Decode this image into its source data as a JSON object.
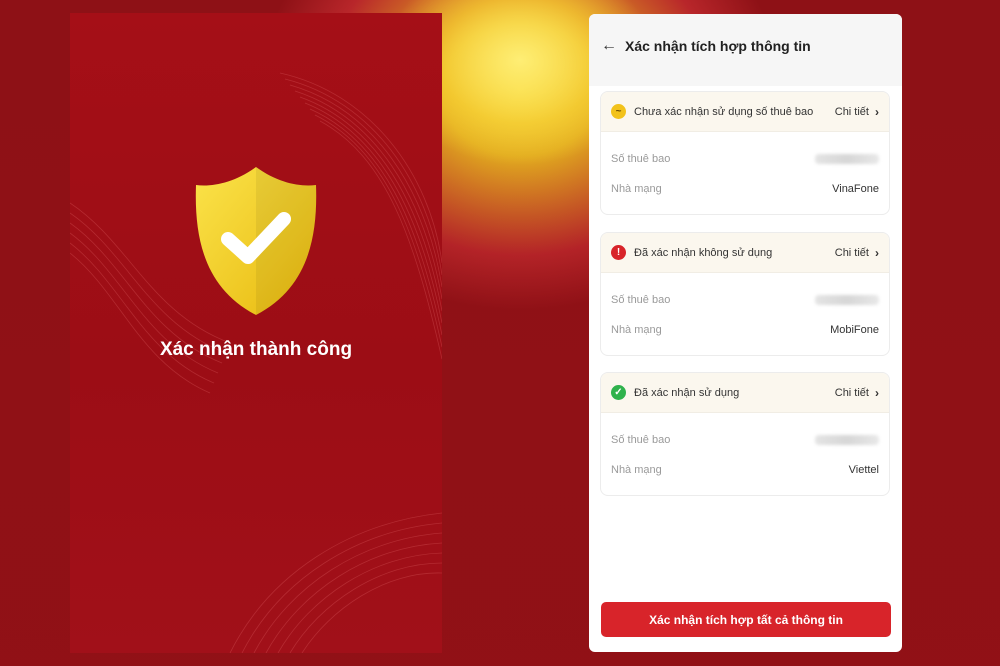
{
  "left_screen": {
    "title": "Xác nhận thành công",
    "shield_icon": "shield-check-icon",
    "colors": {
      "background": "#a50f17",
      "shield": "#f5d21e",
      "check": "#ffffff"
    }
  },
  "right_screen": {
    "header": {
      "back_icon": "arrow-left-icon",
      "back_glyph": "←",
      "title": "Xác nhận tích hợp thông tin"
    },
    "cards": [
      {
        "status": "Chưa xác nhận sử dụng số thuê bao",
        "status_icon": "pending-icon",
        "status_glyph": "~",
        "status_color": "#f2c21b",
        "detail_label": "Chi tiết",
        "fields": [
          {
            "label": "Số thuê bao",
            "value": ""
          },
          {
            "label": "Nhà mạng",
            "value": "VinaFone"
          }
        ]
      },
      {
        "status": "Đã xác nhận không sử dụng",
        "status_icon": "error-icon",
        "status_glyph": "!",
        "status_color": "#d8242a",
        "detail_label": "Chi tiết",
        "fields": [
          {
            "label": "Số thuê bao",
            "value": ""
          },
          {
            "label": "Nhà mạng",
            "value": "MobiFone"
          }
        ]
      },
      {
        "status": "Đã xác nhận sử dụng",
        "status_icon": "check-circle-icon",
        "status_glyph": "✓",
        "status_color": "#2fb24c",
        "detail_label": "Chi tiết",
        "fields": [
          {
            "label": "Số thuê bao",
            "value": ""
          },
          {
            "label": "Nhà mạng",
            "value": "Viettel"
          }
        ]
      }
    ],
    "cta_label": "Xác nhận tích hợp tất cả thông tin",
    "colors": {
      "cta": "#d8242a",
      "card_header": "#fbf7ee"
    }
  }
}
